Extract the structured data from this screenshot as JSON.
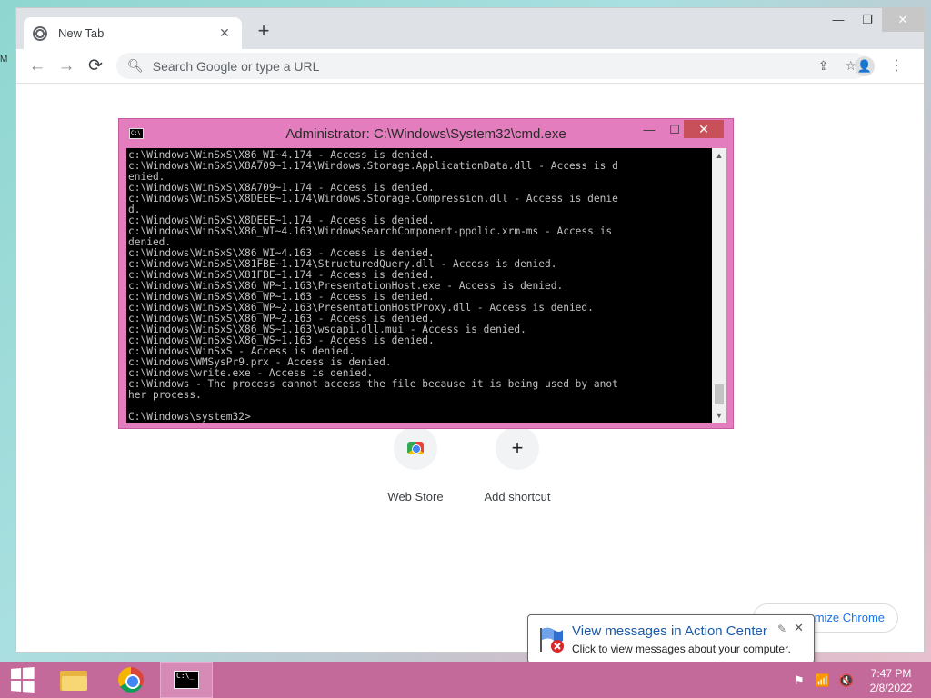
{
  "desktop": {
    "edge_text": "M"
  },
  "chrome": {
    "tab_title": "New Tab",
    "tab_close": "✕",
    "new_tab": "+",
    "window": {
      "minimize": "—",
      "maximize": "❐",
      "close": "✕"
    },
    "back": "←",
    "forward": "→",
    "reload": "⟳",
    "omnibox_placeholder": "Search Google or type a URL",
    "share_icon": "⇪",
    "star_icon": "☆",
    "avatar_icon": "👤",
    "menu_icon": "⋮",
    "shortcuts": [
      {
        "label": "Web Store"
      },
      {
        "label": "Add shortcut",
        "icon": "+"
      }
    ],
    "customize_label": "mize Chrome"
  },
  "cmd": {
    "title": "Administrator: C:\\Windows\\System32\\cmd.exe",
    "icon_text": "C:\\",
    "minimize": "—",
    "maximize": "☐",
    "close": "✕",
    "lines": [
      "c:\\Windows\\WinSxS\\X86_WI~4.174 - Access is denied.",
      "c:\\Windows\\WinSxS\\X8A709~1.174\\Windows.Storage.ApplicationData.dll - Access is d",
      "enied.",
      "c:\\Windows\\WinSxS\\X8A709~1.174 - Access is denied.",
      "c:\\Windows\\WinSxS\\X8DEEE~1.174\\Windows.Storage.Compression.dll - Access is denie",
      "d.",
      "c:\\Windows\\WinSxS\\X8DEEE~1.174 - Access is denied.",
      "c:\\Windows\\WinSxS\\X86_WI~4.163\\WindowsSearchComponent-ppdlic.xrm-ms - Access is",
      "denied.",
      "c:\\Windows\\WinSxS\\X86_WI~4.163 - Access is denied.",
      "c:\\Windows\\WinSxS\\X81FBE~1.174\\StructuredQuery.dll - Access is denied.",
      "c:\\Windows\\WinSxS\\X81FBE~1.174 - Access is denied.",
      "c:\\Windows\\WinSxS\\X86_WP~1.163\\PresentationHost.exe - Access is denied.",
      "c:\\Windows\\WinSxS\\X86_WP~1.163 - Access is denied.",
      "c:\\Windows\\WinSxS\\X86_WP~2.163\\PresentationHostProxy.dll - Access is denied.",
      "c:\\Windows\\WinSxS\\X86_WP~2.163 - Access is denied.",
      "c:\\Windows\\WinSxS\\X86_WS~1.163\\wsdapi.dll.mui - Access is denied.",
      "c:\\Windows\\WinSxS\\X86_WS~1.163 - Access is denied.",
      "c:\\Windows\\WinSxS - Access is denied.",
      "c:\\Windows\\WMSysPr9.prx - Access is denied.",
      "c:\\Windows\\write.exe - Access is denied.",
      "c:\\Windows - The process cannot access the file because it is being used by anot",
      "her process.",
      "",
      "C:\\Windows\\system32>"
    ],
    "scroll_up": "▲",
    "scroll_down": "▼"
  },
  "notification": {
    "title": "View messages in Action Center",
    "body": "Click to view messages about your computer.",
    "pin_icon": "✎",
    "close": "✕"
  },
  "taskbar": {
    "cmd_icon_text": "C:\\_",
    "tray": {
      "flag": "⚑",
      "network": "📶",
      "volume": "🔇"
    },
    "time": "7:47 PM",
    "date": "2/8/2022"
  }
}
